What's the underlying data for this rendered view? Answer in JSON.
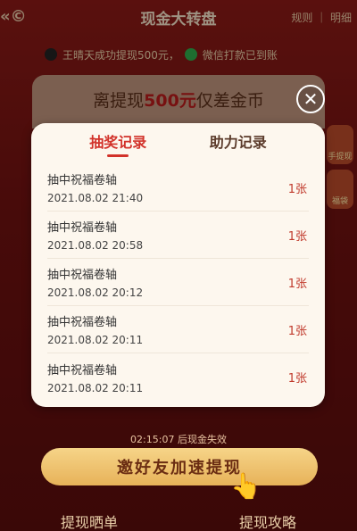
{
  "header": {
    "title": "现金大转盘",
    "back_icon": "«©",
    "right_label": "规则 ｜ 明细"
  },
  "marquee": {
    "text1": "王晴天成功提现500元，",
    "text2": "微信打款已到账"
  },
  "prize": {
    "title_prefix": "离提现",
    "title_amount": "500元",
    "title_suffix": "仅差金币"
  },
  "side": {
    "badge1": "手提现",
    "badge2": "福袋"
  },
  "modal": {
    "tabs": [
      {
        "label": "抽奖记录",
        "active": true
      },
      {
        "label": "助力记录",
        "active": false
      }
    ],
    "records": [
      {
        "name": "抽中祝福卷轴",
        "time": "2021.08.02 21:40",
        "amount": "1张"
      },
      {
        "name": "抽中祝福卷轴",
        "time": "2021.08.02 20:58",
        "amount": "1张"
      },
      {
        "name": "抽中祝福卷轴",
        "time": "2021.08.02 20:12",
        "amount": "1张"
      },
      {
        "name": "抽中祝福卷轴",
        "time": "2021.08.02 20:11",
        "amount": "1张"
      },
      {
        "name": "抽中祝福卷轴",
        "time": "2021.08.02 20:11",
        "amount": "1张"
      }
    ]
  },
  "footer": {
    "countdown": "02:15:07 后现金失效",
    "invite_label": "邀好友加速提现",
    "tabs": [
      "提现晒单",
      "提现攻略"
    ]
  },
  "colors": {
    "accent": "#d2322a",
    "modal_bg": "#fdf7ee",
    "page_bg": "#7a1414"
  }
}
